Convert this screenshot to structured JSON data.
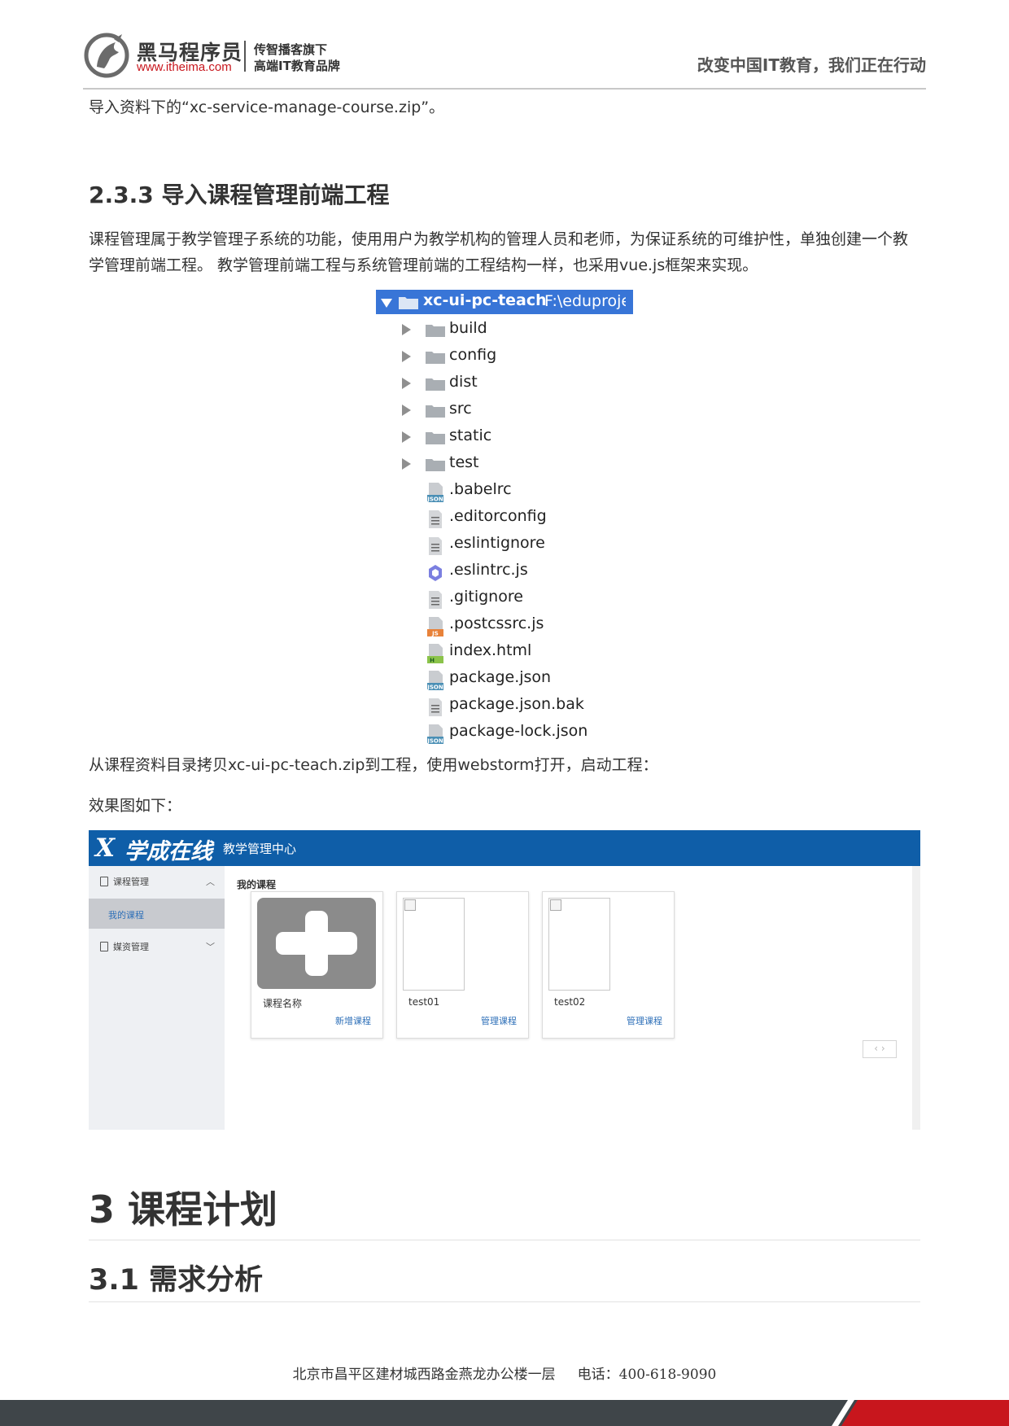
{
  "header": {
    "brand_name": "黑马程序员",
    "brand_url": "www.itheima.com",
    "slogan_line1": "传智播客旗下",
    "slogan_line2": "高端IT教育品牌",
    "tagline": "改变中国IT教育，我们正在行动"
  },
  "content": {
    "intro_line": "导入资料下的“xc-service-manage-course.zip”。",
    "section_233_heading": "2.3.3 导入课程管理前端工程",
    "section_233_para": "课程管理属于教学管理子系统的功能，使用用户为教学机构的管理人员和老师，为保证系统的可维护性，单独创建一个教学管理前端工程。 教学管理前端工程与系统管理前端的工程结构一样，也采用vue.js框架来实现。",
    "copy_para": "从课程资料目录拷贝xc-ui-pc-teach.zip到工程，使用webstorm打开，启动工程：",
    "effect_para": "效果图如下：",
    "section_3_heading": "3 课程计划",
    "section_31_heading": "3.1 需求分析"
  },
  "file_tree": {
    "root_name": "xc-ui-pc-teach",
    "root_path": "F:\\eduproject",
    "folders": [
      "build",
      "config",
      "dist",
      "src",
      "static",
      "test"
    ],
    "files": [
      {
        "name": ".babelrc",
        "icon": "json-file-icon"
      },
      {
        "name": ".editorconfig",
        "icon": "text-file-icon"
      },
      {
        "name": ".eslintignore",
        "icon": "text-file-icon"
      },
      {
        "name": ".eslintrc.js",
        "icon": "eslint-file-icon"
      },
      {
        "name": ".gitignore",
        "icon": "text-file-icon"
      },
      {
        "name": ".postcssrc.js",
        "icon": "js-file-icon"
      },
      {
        "name": "index.html",
        "icon": "html-file-icon"
      },
      {
        "name": "package.json",
        "icon": "json-file-icon"
      },
      {
        "name": "package.json.bak",
        "icon": "text-file-icon"
      },
      {
        "name": "package-lock.json",
        "icon": "json-file-icon"
      }
    ]
  },
  "app": {
    "logo_x": "X",
    "logo_text": "学成在线",
    "subtitle": "教学管理中心",
    "menu": {
      "course_manage": "课程管理",
      "my_courses": "我的课程",
      "media_manage": "媒资管理"
    },
    "main_title": "我的课程",
    "cards": [
      {
        "name": "课程名称",
        "link": "新增课程"
      },
      {
        "name": "test01",
        "link": "管理课程"
      },
      {
        "name": "test02",
        "link": "管理课程"
      }
    ],
    "pager": "‹ ›"
  },
  "footer": {
    "address": "北京市昌平区建材城西路金燕龙办公楼一层     电话：400-618-9090"
  },
  "colors": {
    "brand_red": "#c8161d",
    "tree_selection": "#3875d7",
    "app_header_blue": "#0f5ea8",
    "link_blue": "#2d6fb8",
    "footer_bar": "#3f4549"
  }
}
